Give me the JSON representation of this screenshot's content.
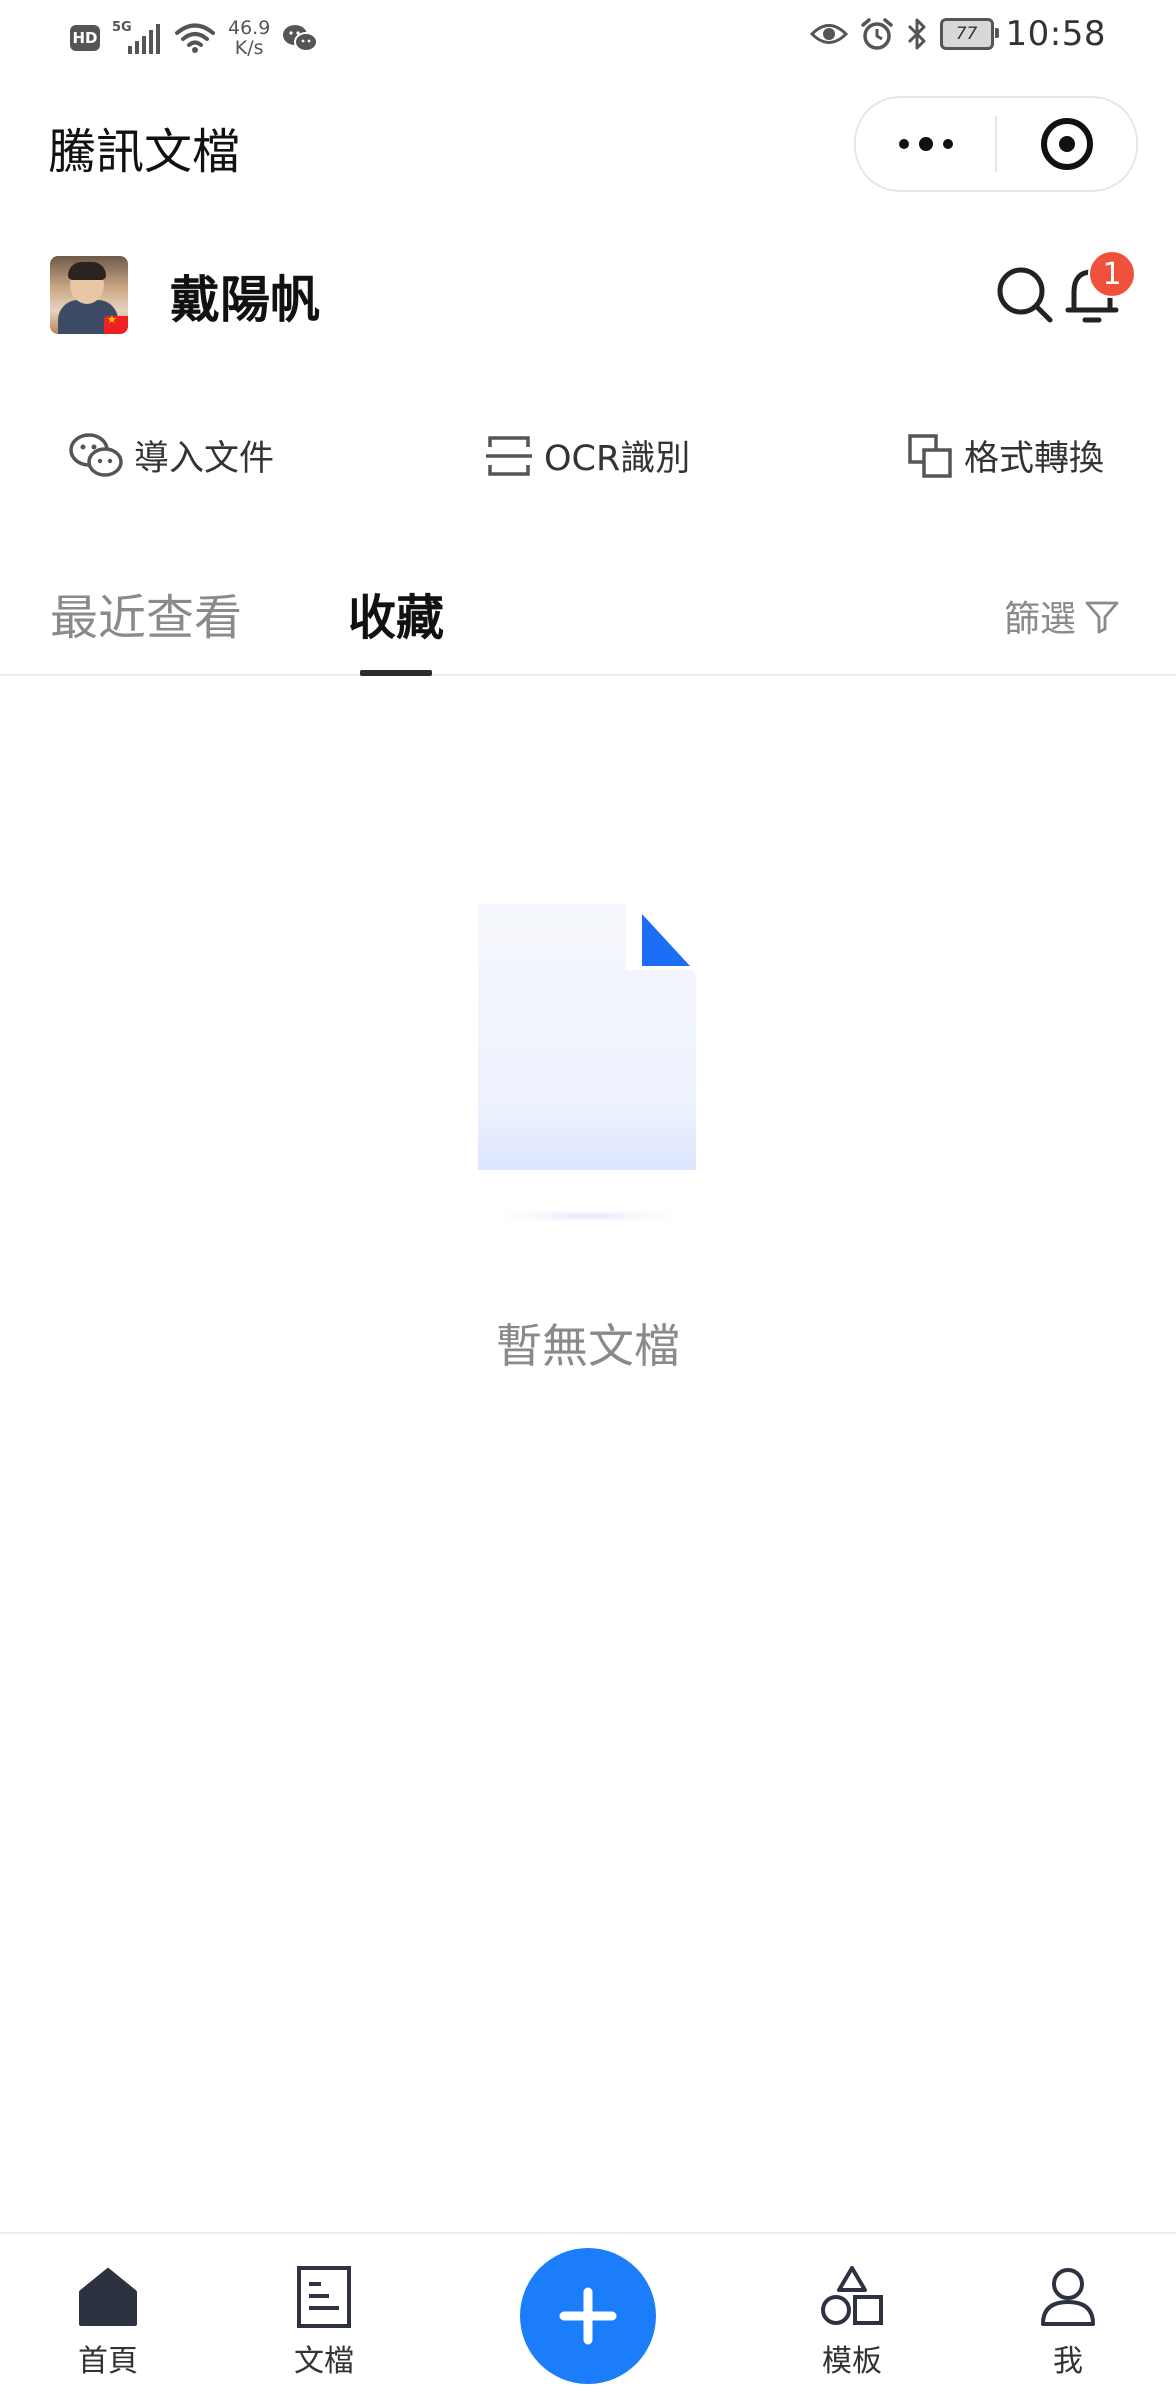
{
  "status_bar": {
    "hd_label": "HD",
    "network_label": "5G",
    "speed_value": "46.9",
    "speed_unit": "K/s",
    "battery_level": "77",
    "time": "10:58"
  },
  "titlebar": {
    "title": "騰訊文檔"
  },
  "user": {
    "name": "戴陽帆",
    "notification_count": "1"
  },
  "quick_actions": [
    {
      "label": "導入文件",
      "icon": "wechat-icon"
    },
    {
      "label": "OCR識別",
      "icon": "scan-icon"
    },
    {
      "label": "格式轉換",
      "icon": "convert-icon"
    }
  ],
  "tabs": {
    "recent_label": "最近查看",
    "favorites_label": "收藏",
    "active": "favorites",
    "filter_label": "篩選"
  },
  "empty_state": {
    "message": "暫無文檔"
  },
  "bottom_nav": {
    "home_label": "首頁",
    "docs_label": "文檔",
    "templates_label": "模板",
    "me_label": "我",
    "accent_color": "#1c7dfa"
  }
}
